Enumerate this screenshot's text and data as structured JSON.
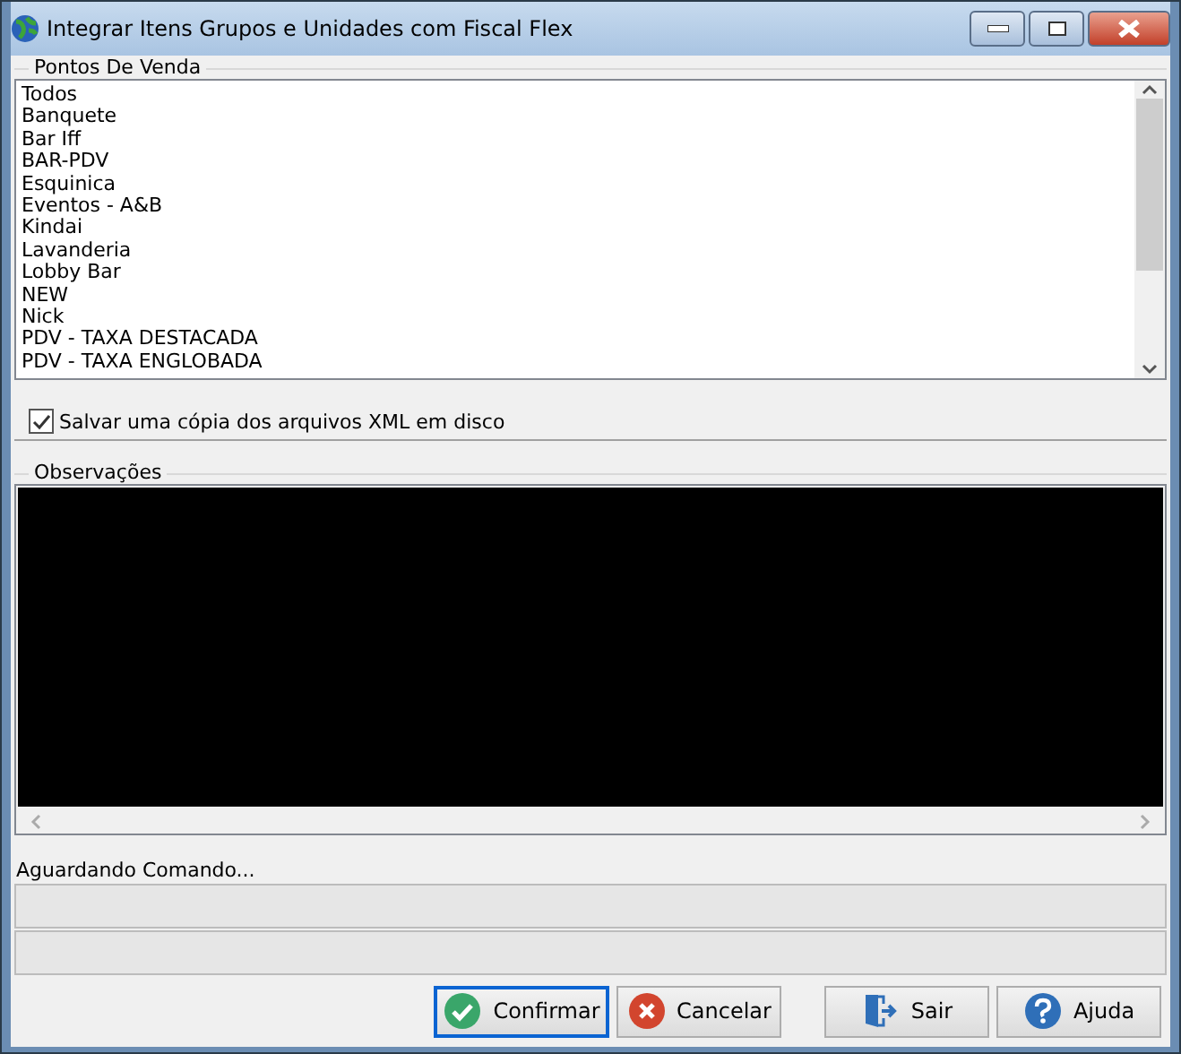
{
  "window": {
    "title": "Integrar Itens Grupos e Unidades com Fiscal Flex"
  },
  "points_of_sale": {
    "label": "Pontos De Venda",
    "items": [
      {
        "label": "Todos"
      },
      {
        "label": "Banquete"
      },
      {
        "label": "Bar Iff"
      },
      {
        "label": "BAR-PDV"
      },
      {
        "label": "Esquinica"
      },
      {
        "label": "Eventos - A&B"
      },
      {
        "label": "Kindai"
      },
      {
        "label": "Lavanderia"
      },
      {
        "label": "Lobby Bar"
      },
      {
        "label": "NEW"
      },
      {
        "label": "Nick"
      },
      {
        "label": "PDV - TAXA DESTACADA"
      },
      {
        "label": "PDV - TAXA ENGLOBADA"
      }
    ]
  },
  "save_xml": {
    "label": "Salvar uma cópia dos arquivos XML em disco",
    "checked": true
  },
  "observations": {
    "label": "Observações"
  },
  "status": {
    "text": "Aguardando Comando..."
  },
  "progress": [
    {
      "level": 0
    },
    {
      "level": 0
    }
  ],
  "buttons": [
    {
      "kind": "confirm",
      "label": "Confirmar",
      "focused": true
    },
    {
      "kind": "cancel",
      "label": "Cancelar",
      "focused": false
    },
    {
      "kind": "exit",
      "label": "Sair",
      "focused": false
    },
    {
      "kind": "help",
      "label": "Ajuda",
      "focused": false
    }
  ]
}
